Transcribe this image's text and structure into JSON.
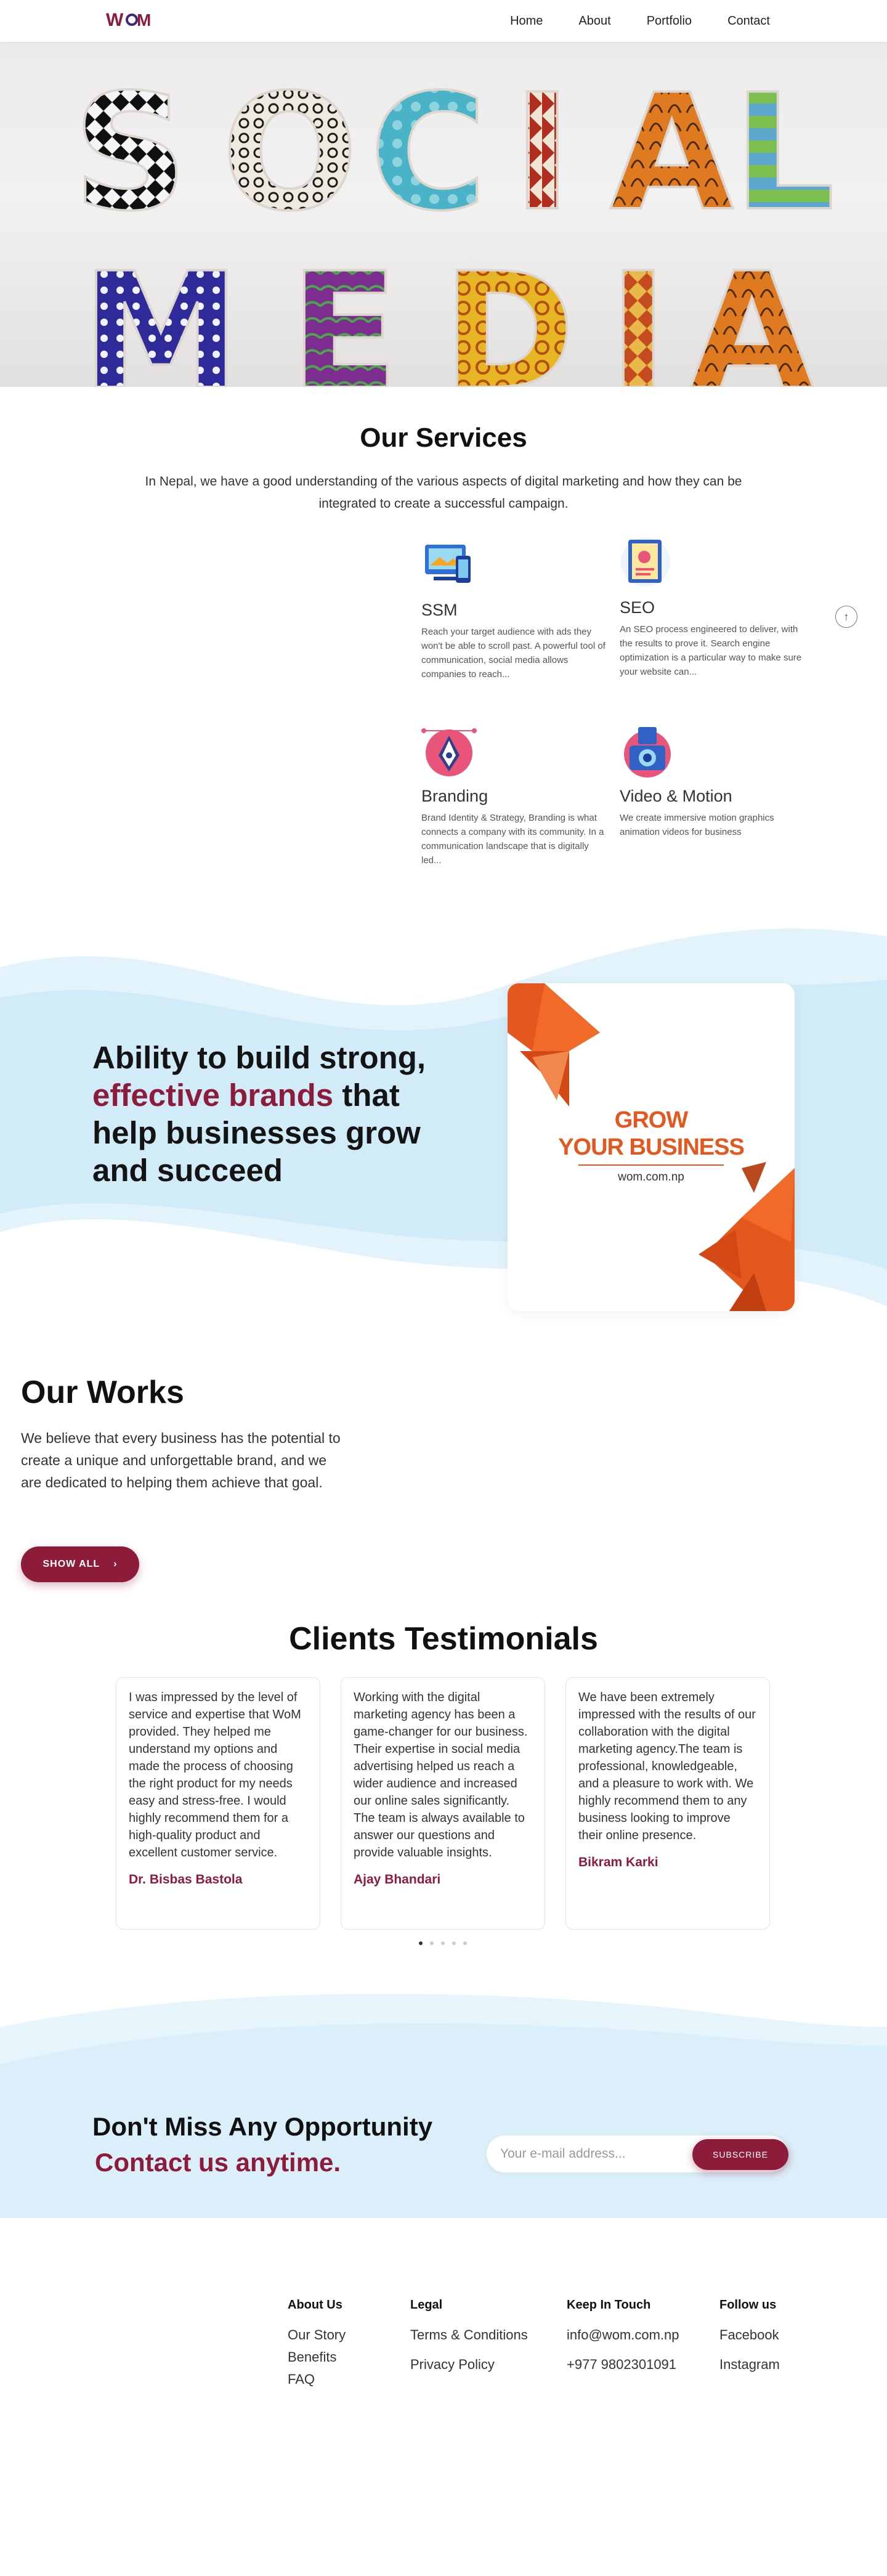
{
  "nav": {
    "logo_text": "WoM",
    "links": [
      "Home",
      "About",
      "Portfolio",
      "Contact"
    ]
  },
  "hero": {
    "row1": [
      "S",
      "O",
      "C",
      "I",
      "A",
      "L"
    ],
    "row2": [
      "M",
      "E",
      "D",
      "I",
      "A"
    ]
  },
  "services": {
    "title": "Our Services",
    "description": "In Nepal, we have a good understanding of the various aspects of digital marketing and how they can be integrated to create a successful campaign.",
    "items": [
      {
        "name": "SSM",
        "text": "Reach your target audience with ads they won't be able to scroll past. A powerful tool of communication, social media allows companies to reach...",
        "icon": "monitor-phone-icon"
      },
      {
        "name": "SEO",
        "text": "An SEO process engineered to deliver, with the results to prove it. Search engine optimization is a particular way to make sure your website can...",
        "icon": "search-document-icon"
      },
      {
        "name": "Branding",
        "text": "Brand Identity & Strategy, Branding is what connects a company with its community. In a communication landscape that is digitally led...",
        "icon": "pen-tool-icon"
      },
      {
        "name": "Video & Motion",
        "text": "We create immersive motion graphics animation videos for business",
        "icon": "camera-icon"
      }
    ]
  },
  "ability": {
    "p1": "Ability to build strong,",
    "accent": "effective brands",
    "p2": "that help businesses grow and succeed"
  },
  "grow_card": {
    "line1": "GROW",
    "line2": "YOUR BUSINESS",
    "url": "wom.com.np"
  },
  "works": {
    "title": "Our Works",
    "description": "We believe that every business has the potential to create a unique and unforgettable brand, and we are dedicated to helping them achieve that goal.",
    "button": "SHOW ALL"
  },
  "testimonials": {
    "title": "Clients Testimonials",
    "items": [
      {
        "text": "I was impressed by the level of service and expertise that WoM provided. They helped me understand my options and made the process of choosing the right product for my needs easy and stress-free. I would highly recommend them for a high-quality product and excellent customer service.",
        "author": "Dr. Bisbas Bastola"
      },
      {
        "text": "Working with the digital marketing agency has been a game-changer for our business. Their expertise in social media advertising helped us reach a wider audience and increased our online sales significantly. The team is always available to answer our questions and provide valuable insights.",
        "author": "Ajay Bhandari"
      },
      {
        "text": "We have been extremely impressed with the results of our collaboration with the digital marketing agency.The team is professional, knowledgeable, and a pleasure to work with. We highly recommend them to any business looking to improve their online presence.",
        "author": "Bikram Karki"
      }
    ],
    "active_dot": 1,
    "dot_count": 5
  },
  "newsletter": {
    "heading": "Don't Miss Any Opportunity",
    "subheading": "Contact us anytime.",
    "placeholder": "Your e-mail address...",
    "button": "SUBSCRIBE"
  },
  "footer": {
    "about": {
      "title": "About Us",
      "links": [
        "Our Story",
        "Benefits",
        "FAQ"
      ]
    },
    "legal": {
      "title": "Legal",
      "links": [
        "Terms & Conditions",
        "Privacy Policy"
      ]
    },
    "contact": {
      "title": "Keep In Touch",
      "links": [
        "info@wom.com.np",
        "+977 9802301091"
      ]
    },
    "follow": {
      "title": "Follow us",
      "links": [
        "Facebook",
        "Instagram"
      ]
    }
  },
  "colors": {
    "brand": "#8c1c3a",
    "accent_orange": "#e4571e",
    "light_blue": "#d6edf9"
  }
}
